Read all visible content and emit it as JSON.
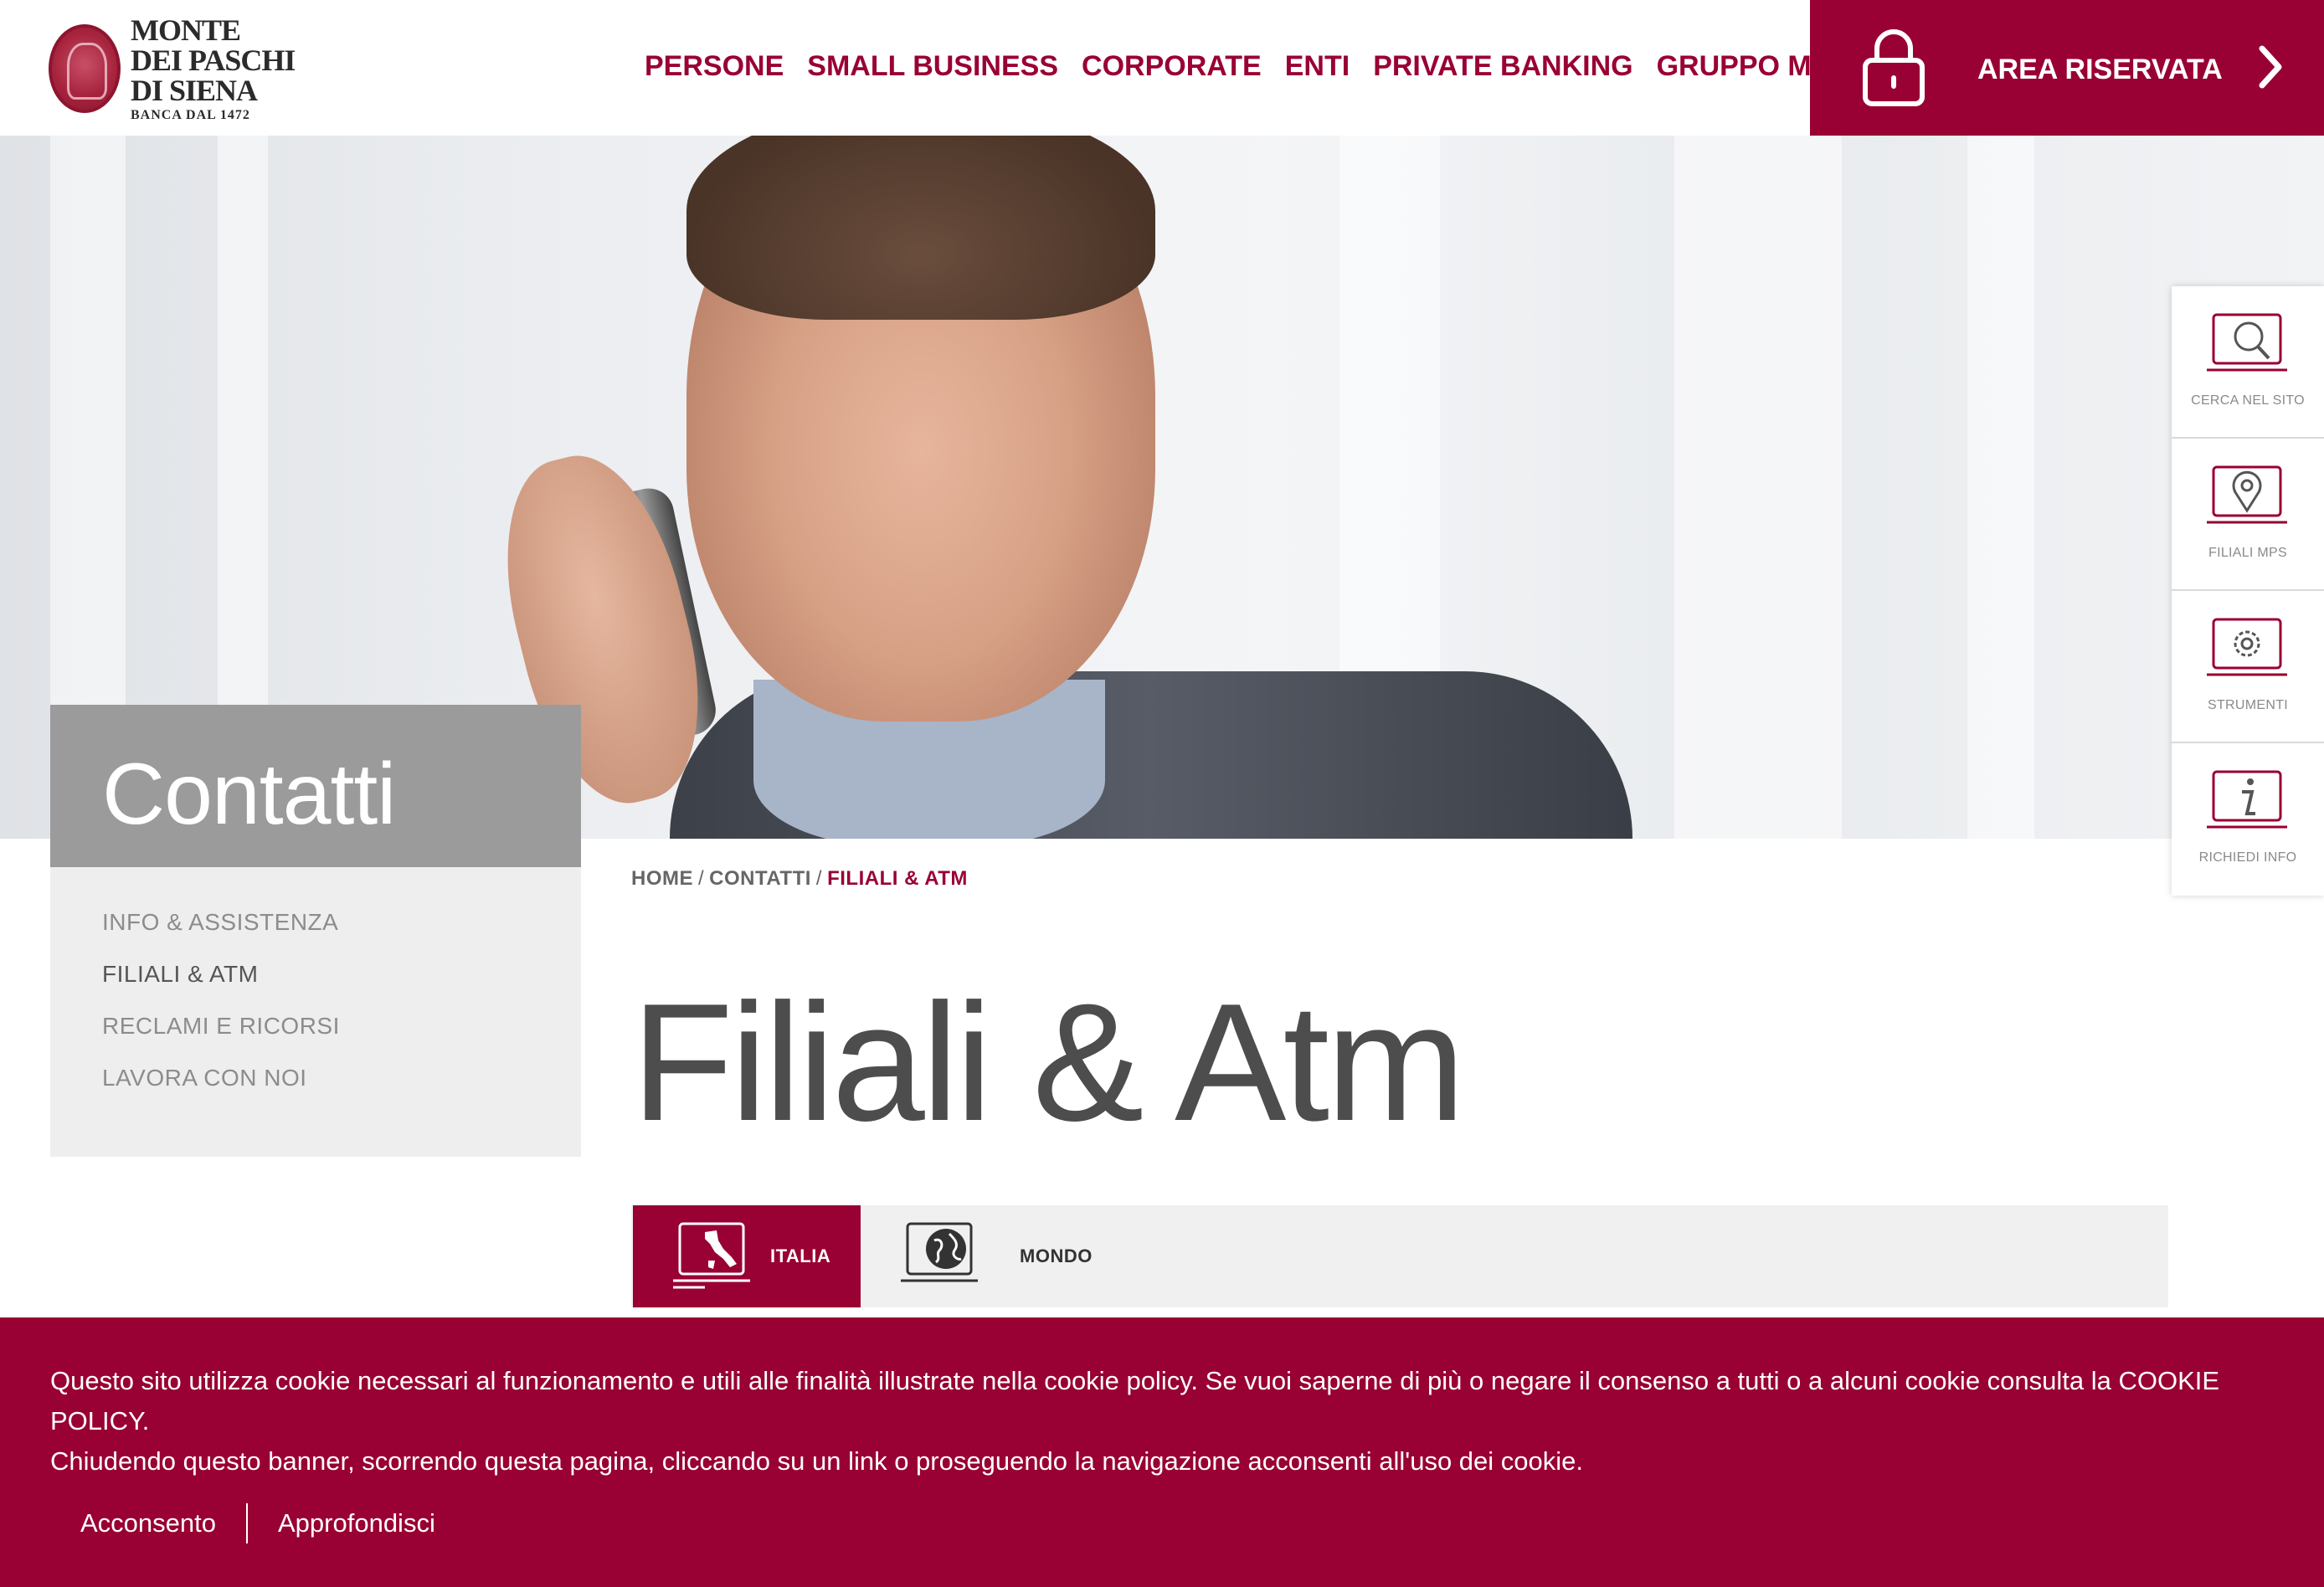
{
  "header": {
    "logo": {
      "line1": "MONTE",
      "line2": "DEI PASCHI",
      "line3": "DI SIENA",
      "tagline": "BANCA DAL 1472"
    },
    "nav": [
      "PERSONE",
      "SMALL BUSINESS",
      "CORPORATE",
      "ENTI",
      "PRIVATE BANKING",
      "GRUPPO MPS"
    ],
    "area_riservata": "AREA RISERVATA"
  },
  "hero": {
    "section_title": "Contatti"
  },
  "submenu": {
    "items": [
      {
        "label": "INFO & ASSISTENZA",
        "active": false
      },
      {
        "label": "FILIALI & ATM",
        "active": true
      },
      {
        "label": "RECLAMI E RICORSI",
        "active": false
      },
      {
        "label": "LAVORA CON NOI",
        "active": false
      }
    ]
  },
  "quickbar": {
    "items": [
      {
        "label": "CERCA NEL SITO",
        "icon": "search-monitor-icon"
      },
      {
        "label": "FILIALI MPS",
        "icon": "map-pin-monitor-icon"
      },
      {
        "label": "STRUMENTI",
        "icon": "gear-monitor-icon"
      },
      {
        "label": "RICHIEDI INFO",
        "icon": "info-monitor-icon"
      }
    ]
  },
  "breadcrumb": {
    "home": "HOME",
    "contatti": "CONTATTI",
    "current": "FILIALI & ATM",
    "separator": "/"
  },
  "page": {
    "title": "Filiali & Atm"
  },
  "tabs": {
    "italia": "ITALIA",
    "mondo": "MONDO",
    "selected": "ITALIA"
  },
  "cookie": {
    "line1": "Questo sito utilizza cookie necessari al funzionamento e utili alle finalità illustrate nella cookie policy. Se vuoi saperne di più o negare il consenso a tutti o a alcuni cookie consulta la COOKIE POLICY.",
    "line2": "Chiudendo questo banner, scorrendo questa pagina, cliccando su un link o proseguendo la navigazione acconsenti all'uso dei cookie.",
    "accept": "Acconsento",
    "more": "Approfondisci"
  },
  "colors": {
    "brand": "#990033",
    "submenu_bg": "#eeeeee",
    "title_box": "#9b9b9b",
    "tabs_bg": "#f0f0f0"
  }
}
